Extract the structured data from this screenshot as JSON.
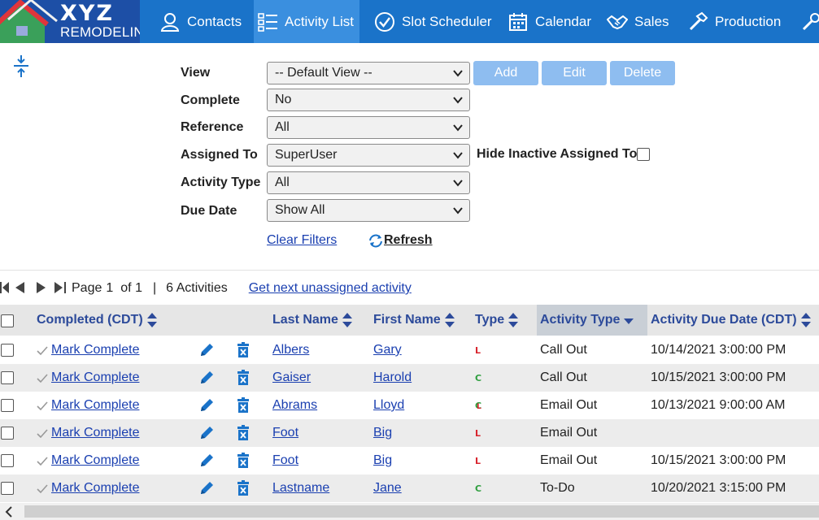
{
  "logo": {
    "top": "XYZ",
    "bottom": "REMODELING"
  },
  "nav": {
    "tabs": [
      {
        "label": "Contacts",
        "icon": "person-icon"
      },
      {
        "label": "Activity List",
        "icon": "checklist-icon",
        "active": true
      },
      {
        "label": "Slot Scheduler",
        "icon": "check-circle-icon"
      },
      {
        "label": "Calendar",
        "icon": "calendar-icon"
      },
      {
        "label": "Sales",
        "icon": "handshake-icon"
      },
      {
        "label": "Production",
        "icon": "hammer-icon"
      }
    ]
  },
  "filters": {
    "view_label": "View",
    "view_value": "-- Default View --",
    "complete_label": "Complete",
    "complete_value": "No",
    "reference_label": "Reference",
    "reference_value": "All",
    "assigned_label": "Assigned To",
    "assigned_value": "SuperUser",
    "activity_type_label": "Activity Type",
    "activity_type_value": "All",
    "due_date_label": "Due Date",
    "due_date_value": "Show All",
    "hide_inactive_label": "Hide Inactive Assigned To",
    "add_label": "Add",
    "edit_label": "Edit",
    "delete_label": "Delete",
    "clear_filters": "Clear Filters",
    "refresh": " Refresh"
  },
  "pager": {
    "page_label": "Page",
    "page": "1",
    "of": "of 1",
    "sep": "|",
    "count": "6 Activities",
    "next_link": "Get next unassigned activity"
  },
  "grid": {
    "headers": {
      "completed": "Completed (CDT)",
      "last_name": "Last Name",
      "first_name": "First Name",
      "type": "Type",
      "activity_type": "Activity Type",
      "due_date": "Activity Due Date (CDT)"
    },
    "rows": [
      {
        "complete": "Mark Complete",
        "last": "Albers",
        "first": "Gary",
        "type": "L",
        "activity": "Call Out",
        "due": "10/14/2021 3:00:00 PM"
      },
      {
        "complete": "Mark Complete",
        "last": "Gaiser",
        "first": "Harold",
        "type": "C",
        "activity": "Call Out",
        "due": "10/15/2021 3:00:00 PM"
      },
      {
        "complete": "Mark Complete",
        "last": "Abrams",
        "first": "Lloyd",
        "type": "CL",
        "activity": "Email Out",
        "due": "10/13/2021 9:00:00 AM"
      },
      {
        "complete": "Mark Complete",
        "last": "Foot",
        "first": "Big",
        "type": "L",
        "activity": "Email Out",
        "due": ""
      },
      {
        "complete": "Mark Complete",
        "last": "Foot",
        "first": "Big",
        "type": "L",
        "activity": "Email Out",
        "due": "10/15/2021 3:00:00 PM"
      },
      {
        "complete": "Mark Complete",
        "last": "Lastname",
        "first": "Jane",
        "type": "C",
        "activity": "To-Do",
        "due": "10/20/2021 3:15:00 PM"
      }
    ]
  },
  "colors": {
    "nav_bg": "#1a73c9",
    "nav_active": "#3a8fdf",
    "link": "#1a3fb0",
    "lead_red": "#d8262f",
    "customer_green": "#2e9e3e"
  }
}
